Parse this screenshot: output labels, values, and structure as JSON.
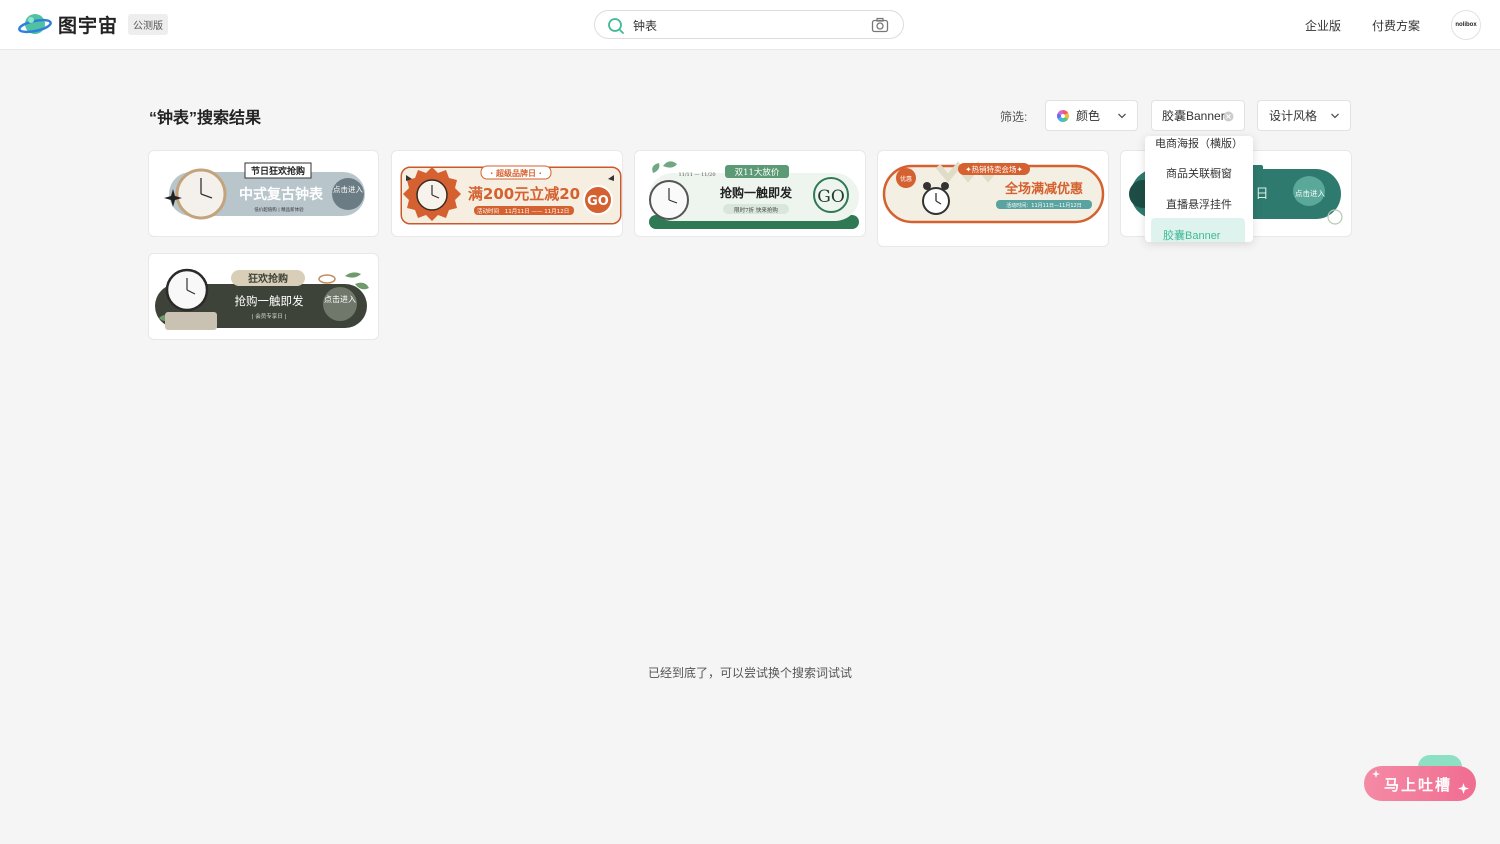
{
  "header": {
    "logo_text": "图宇宙",
    "badge": "公测版",
    "search_value": "钟表",
    "nav": [
      "企业版",
      "付费方案"
    ],
    "avatar_text": "nolibox"
  },
  "page": {
    "title": "“钟表”搜索结果",
    "filter_label": "筛选:",
    "filters": {
      "color": "颜色",
      "type": "胶囊Banner",
      "style": "设计风格"
    }
  },
  "dropdown": {
    "items": [
      "电商海报（横版）",
      "商品关联橱窗",
      "直播悬浮挂件",
      "胶囊Banner"
    ],
    "selected": "胶囊Banner"
  },
  "cards": [
    {
      "top": "节日狂欢抢购",
      "main": "中式复古钟表",
      "sub": "低价超值购 | 精品新体验",
      "btn": "点击进入"
    },
    {
      "top": "· 超级品牌日 ·",
      "main": "满200元立减20",
      "sub_label": "活动时间",
      "sub": "11月11日 —— 11月12日",
      "btn": "GO"
    },
    {
      "top": "双11大放价",
      "date": "11/11 — 11/20",
      "main": "抢购一触即发",
      "sub": "限时7折 快来抢购",
      "btn": "GO"
    },
    {
      "tag": "优惠",
      "top": "✦热销特卖会场✦",
      "main": "全场满减优惠",
      "sub": "活动时间：11月11日—11月12日"
    },
    {
      "main": "日",
      "btn": "点击进入"
    },
    {
      "top": "狂欢抢购",
      "main": "抢购一触即发",
      "sub": "| 会员专享日 |",
      "btn": "点击进入"
    }
  ],
  "footer": {
    "end_text": "已经到底了，可以尝试换个搜索词试试"
  },
  "feedback": {
    "label": "马上吐槽"
  },
  "colors": {
    "accent": "#3fb996",
    "feedback": "#f06d91",
    "background": "#f5f5f5"
  }
}
